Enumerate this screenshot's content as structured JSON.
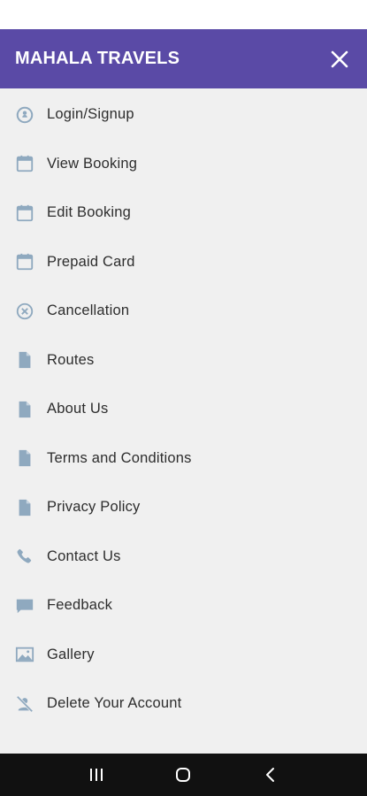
{
  "colors": {
    "header_bg": "#5a4aa6",
    "drawer_bg": "#f0f0f0",
    "icon": "#8fa9bf",
    "nav_bg": "#111111"
  },
  "drawer": {
    "title": "MAHALA TRAVELS",
    "close_icon": "close-icon",
    "items": [
      {
        "label": "Login/Signup",
        "icon": "user-circle-icon"
      },
      {
        "label": "View Booking",
        "icon": "calendar-icon"
      },
      {
        "label": "Edit Booking",
        "icon": "calendar-icon"
      },
      {
        "label": "Prepaid Card",
        "icon": "calendar-icon"
      },
      {
        "label": "Cancellation",
        "icon": "cancel-circle-icon"
      },
      {
        "label": "Routes",
        "icon": "document-icon"
      },
      {
        "label": "About Us",
        "icon": "document-icon"
      },
      {
        "label": "Terms and Conditions",
        "icon": "document-icon"
      },
      {
        "label": "Privacy Policy",
        "icon": "document-icon"
      },
      {
        "label": "Contact Us",
        "icon": "phone-icon"
      },
      {
        "label": "Feedback",
        "icon": "message-icon"
      },
      {
        "label": "Gallery",
        "icon": "image-icon"
      },
      {
        "label": "Delete Your Account",
        "icon": "delete-user-icon"
      }
    ]
  },
  "nav_bar": {
    "recents_icon": "recents-icon",
    "home_icon": "home-icon",
    "back_icon": "back-icon"
  }
}
